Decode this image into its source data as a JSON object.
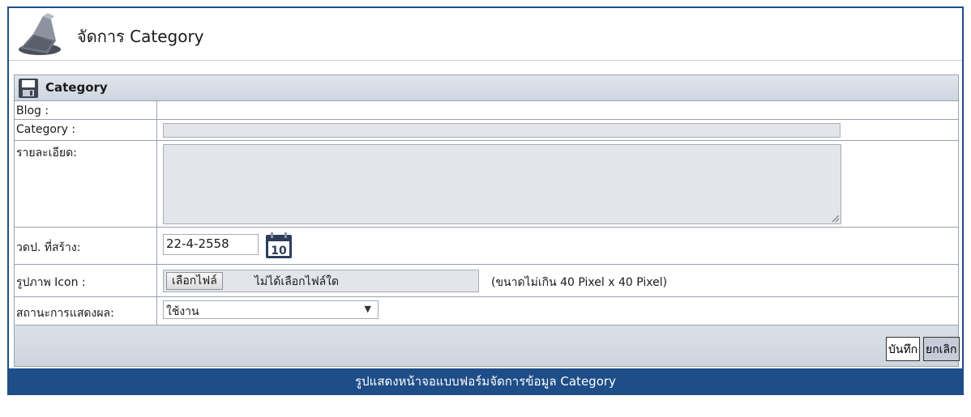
{
  "header": {
    "title": "จัดการ Category",
    "icon": "brush-icon"
  },
  "panel": {
    "title": "Category",
    "icon": "save-icon"
  },
  "form": {
    "blog_label": "Blog :",
    "category_label": "Category :",
    "category_value": "",
    "detail_label": "รายละเอียด:",
    "detail_value": "",
    "date_label": "วดป. ที่สร้าง:",
    "date_value": "22-4-2558",
    "calendar_day": "10",
    "icon_label": "รูปภาพ Icon :",
    "file_button": "เลือกไฟล์",
    "file_status": "ไม่ได้เลือกไฟล์ใด",
    "file_hint": "(ขนาดไม่เกิน 40 Pixel x 40 Pixel)",
    "status_label": "สถานะการแสดงผล:",
    "status_value": "ใช้งาน"
  },
  "buttons": {
    "save": "บันทึก",
    "cancel": "ยกเลิก"
  },
  "caption": "รูปแสดงหน้าจอแบบฟอร์มจัดการข้อมูล Category",
  "colors": {
    "accent": "#1e4d88",
    "panel_header": "#d7dde6",
    "input_bg": "#e3e5ea"
  }
}
